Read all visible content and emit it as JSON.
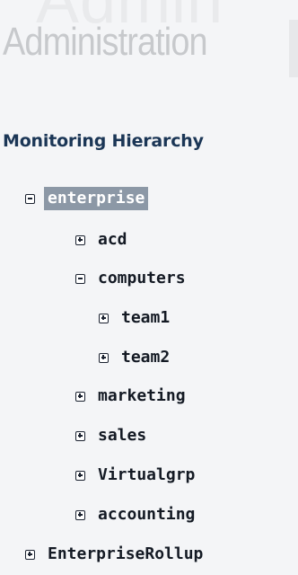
{
  "header": {
    "title": "Administration",
    "watermark": "Admin"
  },
  "section": {
    "title": "Monitoring Hierarchy"
  },
  "tree": {
    "nodes": [
      {
        "label": "enterprise",
        "toggle": "collapse",
        "selected": true
      },
      {
        "label": "acd",
        "toggle": "expand"
      },
      {
        "label": "computers",
        "toggle": "collapse"
      },
      {
        "label": "team1",
        "toggle": "expand"
      },
      {
        "label": "team2",
        "toggle": "expand"
      },
      {
        "label": "marketing",
        "toggle": "expand"
      },
      {
        "label": "sales",
        "toggle": "expand"
      },
      {
        "label": "Virtualgrp",
        "toggle": "expand"
      },
      {
        "label": "accounting",
        "toggle": "expand"
      },
      {
        "label": "EnterpriseRollup",
        "toggle": "expand"
      }
    ]
  },
  "colors": {
    "background": "#f4f5f7",
    "section_title": "#1b3656",
    "selected_bg": "#8c98a6",
    "node_text": "#141a24",
    "header_text": "#c7c9cc"
  },
  "icons": {
    "expand": "plus-box-icon",
    "collapse": "minus-box-icon"
  }
}
